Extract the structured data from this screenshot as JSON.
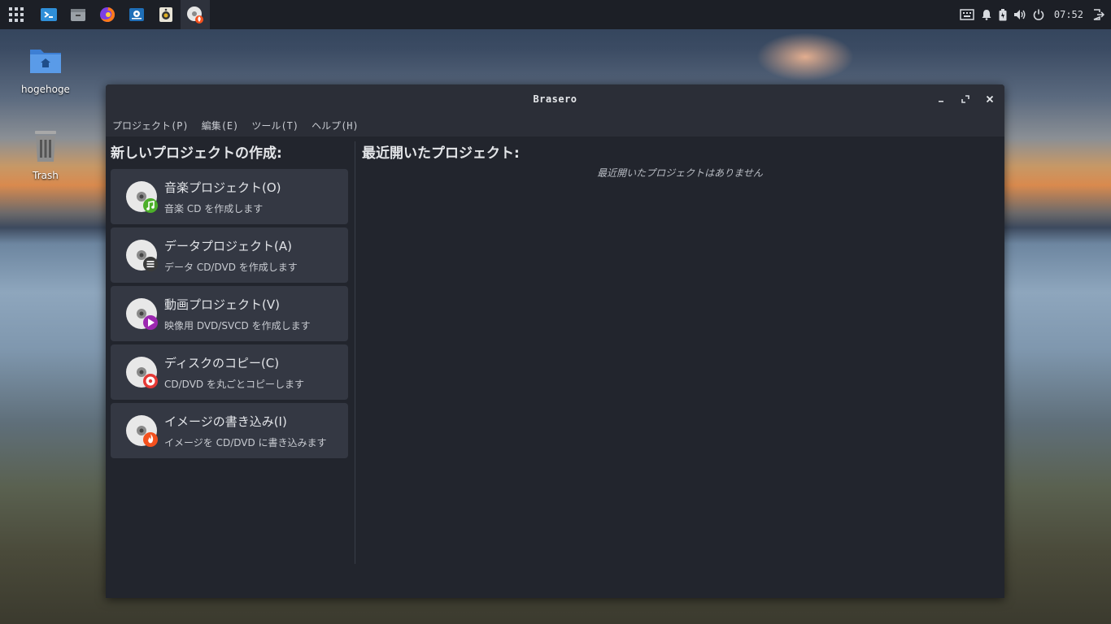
{
  "colors": {
    "panel_bg": "#1c1f26",
    "window_bg": "#22252d",
    "titlebar_bg": "#2b2e37",
    "card_bg": "#343843",
    "music_badge": "#4caf2a",
    "data_badge": "#3a3a3a",
    "video_badge": "#9c27b0",
    "copy_badge": "#e53935",
    "burn_badge": "#f4511e"
  },
  "taskbar": {
    "apps": [
      "app-grid-icon",
      "vscode-icon",
      "file-manager-icon",
      "firefox-icon",
      "software-center-icon",
      "speaker-app-icon",
      "brasero-icon"
    ],
    "clock": "07:52"
  },
  "desktop": {
    "home_folder_label": "hogehoge",
    "trash_label": "Trash"
  },
  "window": {
    "title": "Brasero",
    "menu": [
      "プロジェクト(P)",
      "編集(E)",
      "ツール(T)",
      "ヘルプ(H)"
    ],
    "left_title": "新しいプロジェクトの作成:",
    "right_title": "最近開いたプロジェクト:",
    "empty_message": "最近開いたプロジェクトはありません",
    "projects": [
      {
        "title": "音楽プロジェクト(O)",
        "desc": "音楽 CD を作成します",
        "badge": "music-note-icon"
      },
      {
        "title": "データプロジェクト(A)",
        "desc": "データ CD/DVD を作成します",
        "badge": "data-list-icon"
      },
      {
        "title": "動画プロジェクト(V)",
        "desc": "映像用 DVD/SVCD を作成します",
        "badge": "play-icon"
      },
      {
        "title": "ディスクのコピー(C)",
        "desc": "CD/DVD を丸ごとコピーします",
        "badge": "disc-copy-icon"
      },
      {
        "title": "イメージの書き込み(I)",
        "desc": "イメージを CD/DVD に書き込みます",
        "badge": "flame-icon"
      }
    ]
  }
}
